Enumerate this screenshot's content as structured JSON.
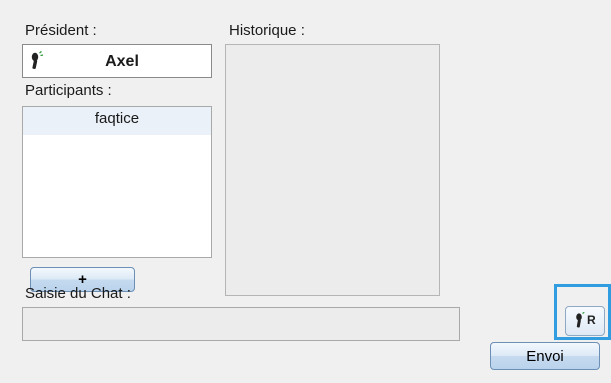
{
  "president": {
    "label": "Président :",
    "name": "Axel",
    "icon": "microphone-icon"
  },
  "historique": {
    "label": "Historique :"
  },
  "participants": {
    "label": "Participants :",
    "items": [
      "faqtice"
    ]
  },
  "add_button": {
    "label": "+"
  },
  "chat": {
    "label": "Saisie du Chat :",
    "value": "",
    "placeholder": ""
  },
  "send_button": {
    "label": "Envoi"
  },
  "recorder_button": {
    "icon": "microphone-icon",
    "letter": "R"
  },
  "colors": {
    "highlight": "#2f9de0",
    "button_border": "#6b8fb5",
    "list_selected": "#eaf1f8"
  }
}
